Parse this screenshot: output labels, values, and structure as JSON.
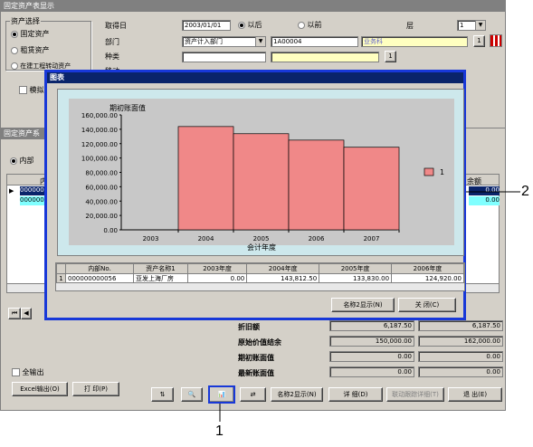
{
  "window": {
    "title": "固定资产表显示"
  },
  "asset_select": {
    "label": "资产选择",
    "options": [
      "固定资产",
      "租赁资产",
      "在建工程转动资产"
    ],
    "selected": 0
  },
  "filters": {
    "acq_date_label": "取得日",
    "acq_date": "2003/01/01",
    "after_label": "以后",
    "before_label": "以前",
    "level_label": "层",
    "level_value": "1",
    "dept_label": "部门",
    "dept_value": "资产计入部门",
    "dept_code": "1A00004",
    "dept_name": "业务科",
    "type_label": "种类",
    "move_label": "移动",
    "one": "1"
  },
  "simulate_label": "模拟",
  "lower": {
    "title": "固定资产系",
    "radio_label": "内部",
    "col_header": "内",
    "right_header": "余额",
    "rows": [
      "0000000",
      "0000000"
    ],
    "right_values": [
      "0.00",
      "0.00"
    ]
  },
  "summary": {
    "labels": [
      "折旧额",
      "原始价值结余",
      "期初账面值",
      "最新账面值"
    ],
    "col1": [
      "6,187.50",
      "150,000.00",
      "0.00",
      "0.00"
    ],
    "col2": [
      "6,187.50",
      "162,000.00",
      "0.00",
      "0.00"
    ]
  },
  "bottom": {
    "all_output": "全输出",
    "excel_btn": "Excel输出(O)",
    "print_btn": "打 印(P)",
    "name2_btn": "名称2显示(N)",
    "detail_btn": "详 细(D)",
    "link_btn": "联动跟踪详细(T)",
    "exit_btn": "退 出(E)"
  },
  "dialog": {
    "title": "图表",
    "table_headers": [
      "内部No.",
      "资产名称1",
      "2003年度",
      "2004年度",
      "2005年度",
      "2006年度"
    ],
    "table_row": [
      "1",
      "000000000056",
      "亚发上海厂房",
      "0.00",
      "143,812.50",
      "133,830.00",
      "124,920.00"
    ],
    "name2_btn": "名称2显示(N)",
    "close_btn": "关 闭(C)"
  },
  "callouts": [
    "1",
    "2"
  ],
  "chart_data": {
    "type": "bar",
    "ylabel": "期初账面值",
    "xlabel": "会计年度",
    "categories": [
      "2003",
      "2004",
      "2005",
      "2006",
      "2007"
    ],
    "series": [
      {
        "name": "1",
        "values": [
          0,
          143812.5,
          133830,
          124920,
          115000
        ]
      }
    ],
    "ylim": [
      0,
      160000
    ],
    "yticks": [
      "160,000.00",
      "140,000.00",
      "120,000.00",
      "100,000.00",
      "80,000.00",
      "60,000.00",
      "40,000.00",
      "20,000.00",
      "0.00"
    ],
    "legend": "right",
    "bar_color": "#f08888"
  }
}
